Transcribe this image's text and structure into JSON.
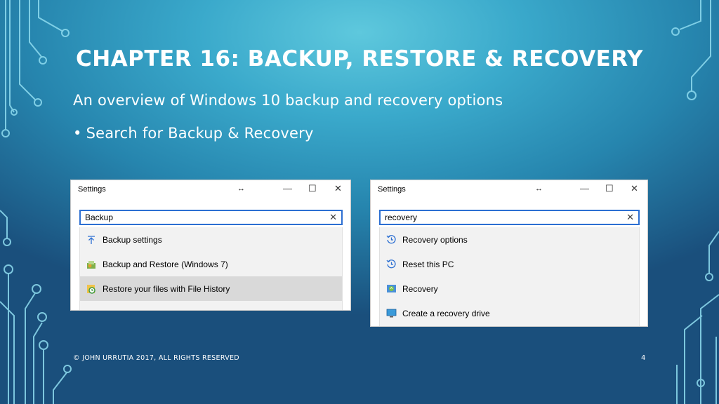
{
  "slide": {
    "title": "CHAPTER 16: BACKUP, RESTORE & RECOVERY",
    "subtitle": "An overview of Windows 10 backup and recovery options",
    "bullet": "Search for Backup & Recovery",
    "bullet_glyph": "•",
    "footer": "© JOHN URRUTIA 2017, ALL RIGHTS RESERVED",
    "page_number": "4"
  },
  "colors": {
    "accent_search_border": "#2c6fd2",
    "selected_row": "#d9d9d9",
    "list_background": "#f2f2f2"
  },
  "windows": [
    {
      "title": "Settings",
      "resize_glyph": "↔",
      "minimize_glyph": "—",
      "maximize_glyph": "☐",
      "close_glyph": "✕",
      "search_value": "Backup",
      "search_clear_glyph": "✕",
      "results": [
        {
          "label": "Backup settings",
          "icon": "upload-arrow-icon",
          "selected": false
        },
        {
          "label": "Backup and Restore (Windows 7)",
          "icon": "backup-restore-icon",
          "selected": false
        },
        {
          "label": "Restore your files with File History",
          "icon": "file-history-icon",
          "selected": true
        }
      ]
    },
    {
      "title": "Settings",
      "resize_glyph": "↔",
      "minimize_glyph": "—",
      "maximize_glyph": "☐",
      "close_glyph": "✕",
      "search_value": "recovery",
      "search_clear_glyph": "✕",
      "results": [
        {
          "label": "Recovery options",
          "icon": "history-clock-icon",
          "selected": false
        },
        {
          "label": "Reset this PC",
          "icon": "history-clock-icon",
          "selected": false
        },
        {
          "label": "Recovery",
          "icon": "recovery-control-panel-icon",
          "selected": false
        },
        {
          "label": "Create a recovery drive",
          "icon": "monitor-icon",
          "selected": false
        }
      ]
    }
  ]
}
